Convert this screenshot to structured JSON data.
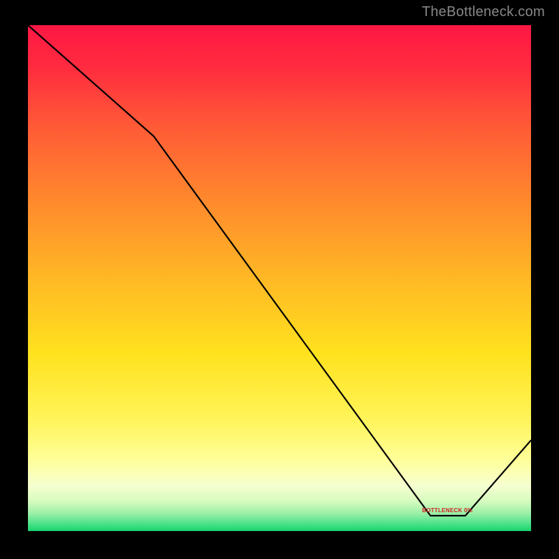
{
  "attribution": "TheBottleneck.com",
  "overlay_label": "BOTTLENECK 0%",
  "chart_data": {
    "type": "line",
    "title": "",
    "xlabel": "",
    "ylabel": "",
    "xlim": [
      0,
      100
    ],
    "ylim": [
      0,
      100
    ],
    "background": "rainbow-gradient (red top to green bottom)",
    "series": [
      {
        "name": "bottleneck-curve",
        "color": "#000000",
        "x": [
          0,
          25,
          80,
          87,
          100
        ],
        "values": [
          100,
          78,
          3,
          3,
          18
        ]
      }
    ],
    "optimal_region_x": [
      78,
      90
    ],
    "notes": "V-shaped curve reaching minimum (~3%) near x≈80-87, ascending at far right. Optimal flat zone labeled in red near the minimum."
  }
}
